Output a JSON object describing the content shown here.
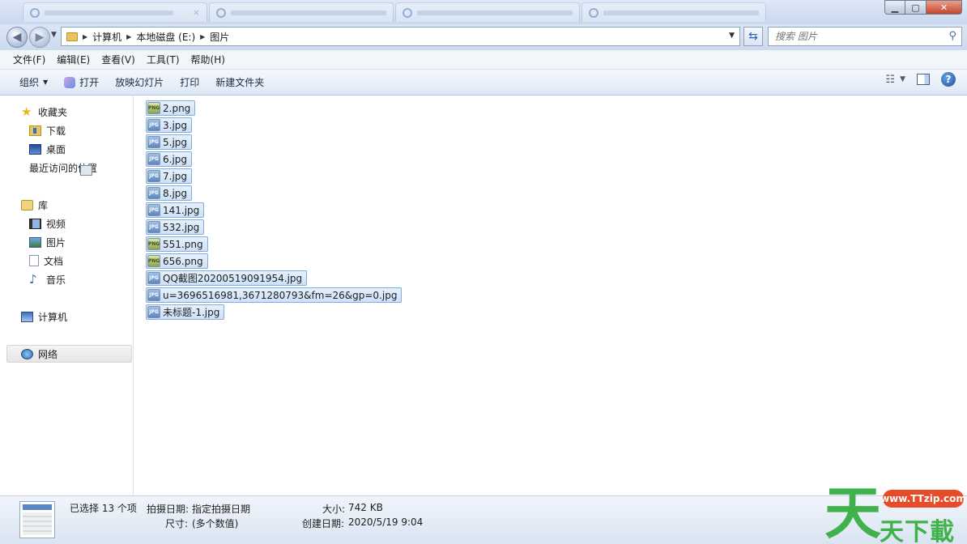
{
  "window": {
    "tabs": [
      "",
      "",
      "",
      "",
      ""
    ],
    "tab_close": "×"
  },
  "navigation": {
    "back": "◀",
    "forward": "▶",
    "recent": "▼"
  },
  "address": {
    "crumbs": [
      "计算机",
      "本地磁盘 (E:)",
      "图片"
    ],
    "separator": "▶",
    "dropdown": "▼"
  },
  "search": {
    "placeholder": "搜索 图片"
  },
  "menu": [
    "文件(F)",
    "编辑(E)",
    "查看(V)",
    "工具(T)",
    "帮助(H)"
  ],
  "toolbar": {
    "organize": "组织",
    "open": "打开",
    "slideshow": "放映幻灯片",
    "print": "打印",
    "new_folder": "新建文件夹",
    "dropdown": "▼",
    "help": "?"
  },
  "sidebar": {
    "favorites": "收藏夹",
    "downloads": "下载",
    "desktop": "桌面",
    "recent_places": "最近访问的位置",
    "libraries": "库",
    "videos": "视频",
    "pictures": "图片",
    "documents": "文档",
    "music": "音乐",
    "computer": "计算机",
    "network": "网络"
  },
  "files": [
    {
      "name": "2.png",
      "type": "PNG"
    },
    {
      "name": "3.jpg",
      "type": "JPG"
    },
    {
      "name": "5.jpg",
      "type": "JPG"
    },
    {
      "name": "6.jpg",
      "type": "JPG"
    },
    {
      "name": "7.jpg",
      "type": "JPG"
    },
    {
      "name": "8.jpg",
      "type": "JPG"
    },
    {
      "name": "141.jpg",
      "type": "JPG"
    },
    {
      "name": "532.jpg",
      "type": "JPG"
    },
    {
      "name": "551.png",
      "type": "PNG"
    },
    {
      "name": "656.png",
      "type": "PNG"
    },
    {
      "name": "QQ截图20200519091954.jpg",
      "type": "JPG"
    },
    {
      "name": "u=3696516981,3671280793&fm=26&gp=0.jpg",
      "type": "JPG"
    },
    {
      "name": "未标题-1.jpg",
      "type": "JPG"
    }
  ],
  "status": {
    "selected": "已选择 13 个项",
    "date_taken_label": "拍摄日期:",
    "date_taken_value": "指定拍摄日期",
    "size_label": "大小:",
    "size_value": "742 KB",
    "dimensions_label": "尺寸:",
    "dimensions_value": "(多个数值)",
    "created_label": "创建日期:",
    "created_value": "2020/5/19 9:04"
  },
  "watermark": {
    "big": "天",
    "url": "www.TTzip.com",
    "sub": "天下載"
  },
  "colors": {
    "selection_fill": "#cde1f8",
    "selection_border": "#84acdd",
    "watermark_green": "#41b14b",
    "watermark_red": "#e74b2a"
  }
}
